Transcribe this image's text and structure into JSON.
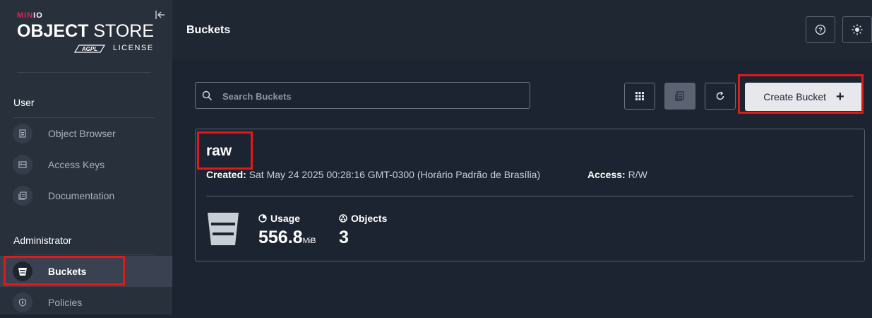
{
  "sidebar": {
    "logo": {
      "brand_min": "MIN",
      "brand_io": "IO",
      "product_bold": "OBJECT",
      "product_rest": " STORE",
      "badge": "AGPL",
      "license": "LICENSE"
    },
    "sections": [
      {
        "title": "User",
        "items": [
          {
            "label": "Object Browser",
            "icon": "object-browser-icon"
          },
          {
            "label": "Access Keys",
            "icon": "access-keys-icon"
          },
          {
            "label": "Documentation",
            "icon": "documentation-icon"
          }
        ]
      },
      {
        "title": "Administrator",
        "items": [
          {
            "label": "Buckets",
            "icon": "bucket-icon",
            "active": true
          },
          {
            "label": "Policies",
            "icon": "policies-icon"
          }
        ]
      }
    ]
  },
  "header": {
    "title": "Buckets",
    "help_icon": "help-icon",
    "theme_icon": "sun-icon"
  },
  "toolbar": {
    "search_placeholder": "Search Buckets",
    "create_label": "Create Bucket",
    "create_icon": "plus-icon"
  },
  "bucket": {
    "name": "raw",
    "created_label": "Created:",
    "created_value": "Sat May 24 2025 00:28:16 GMT-0300 (Horário Padrão de Brasília)",
    "access_label": "Access:",
    "access_value": "R/W",
    "usage_label": "Usage",
    "usage_value": "556.8",
    "usage_unit": "MiB",
    "objects_label": "Objects",
    "objects_value": "3"
  },
  "colors": {
    "highlight": "#e01919",
    "background": "#1c2432",
    "sidebar": "#28303c"
  }
}
